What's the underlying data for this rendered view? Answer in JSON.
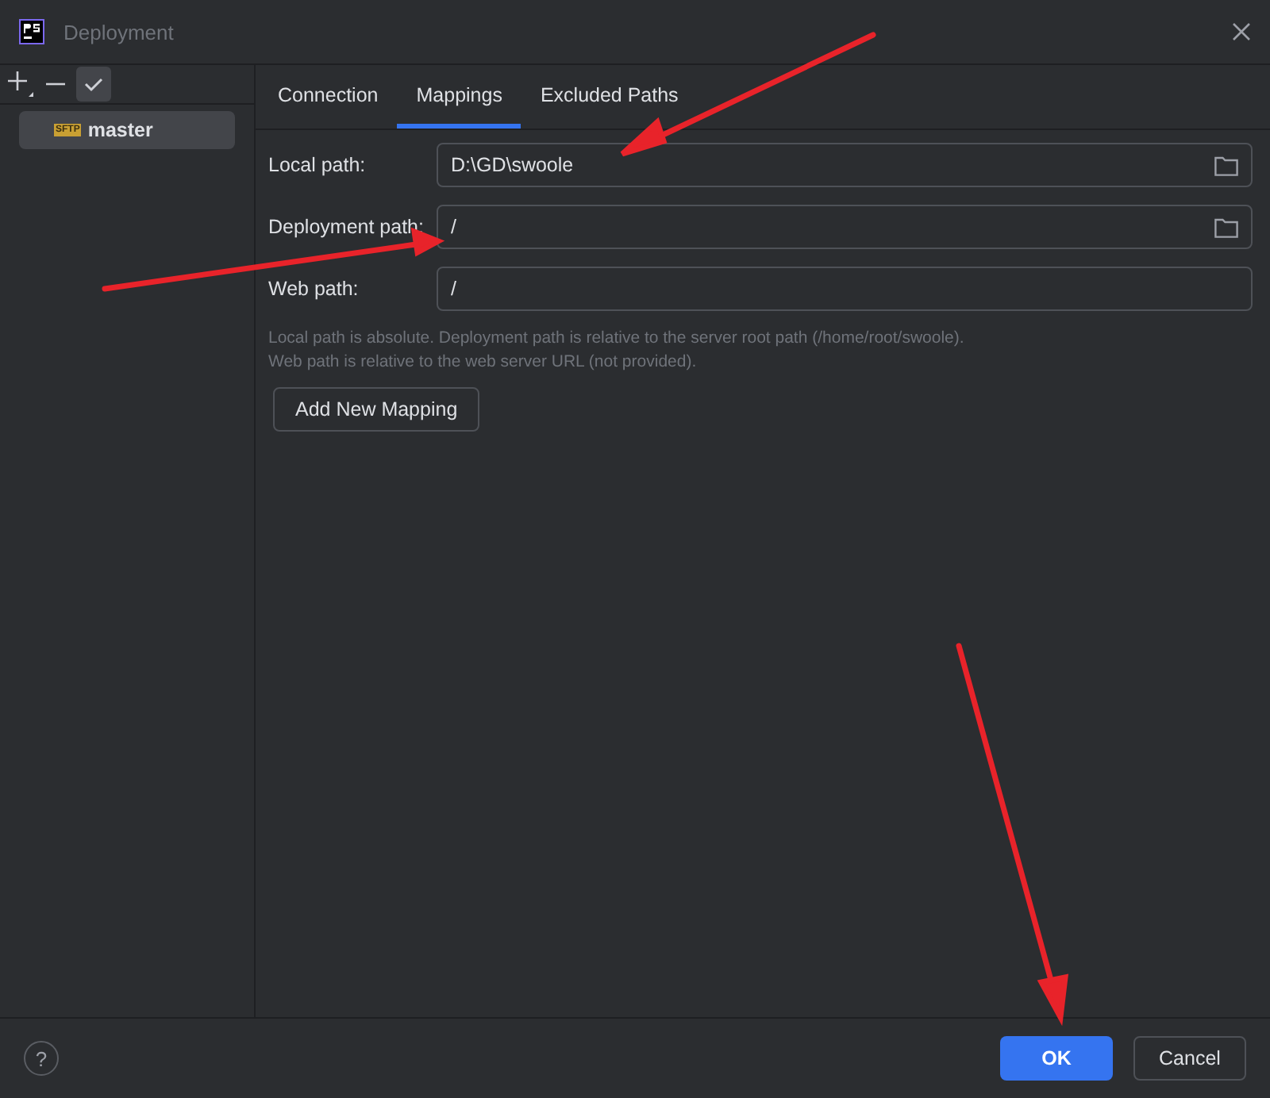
{
  "window": {
    "title": "Deployment"
  },
  "sidebar": {
    "items": [
      {
        "label": "master",
        "badge": "SFTP",
        "selected": true
      }
    ]
  },
  "tabs": [
    {
      "label": "Connection",
      "selected": false
    },
    {
      "label": "Mappings",
      "selected": true
    },
    {
      "label": "Excluded Paths",
      "selected": false
    }
  ],
  "fields": [
    {
      "label": "Local path:",
      "value": "D:\\GD\\swoole",
      "browse": true
    },
    {
      "label": "Deployment path:",
      "value": "/",
      "browse": true
    },
    {
      "label": "Web path:",
      "value": "/",
      "browse": false
    }
  ],
  "hint": [
    "Local path is absolute. Deployment path is relative to the server root path (/home/root/swoole).",
    "Web path is relative to the web server URL (not provided)."
  ],
  "add_button": "Add New Mapping",
  "footer": {
    "help": "?",
    "buttons": [
      {
        "label": "OK",
        "kind": "primary"
      },
      {
        "label": "Cancel",
        "kind": "secondary"
      }
    ]
  }
}
